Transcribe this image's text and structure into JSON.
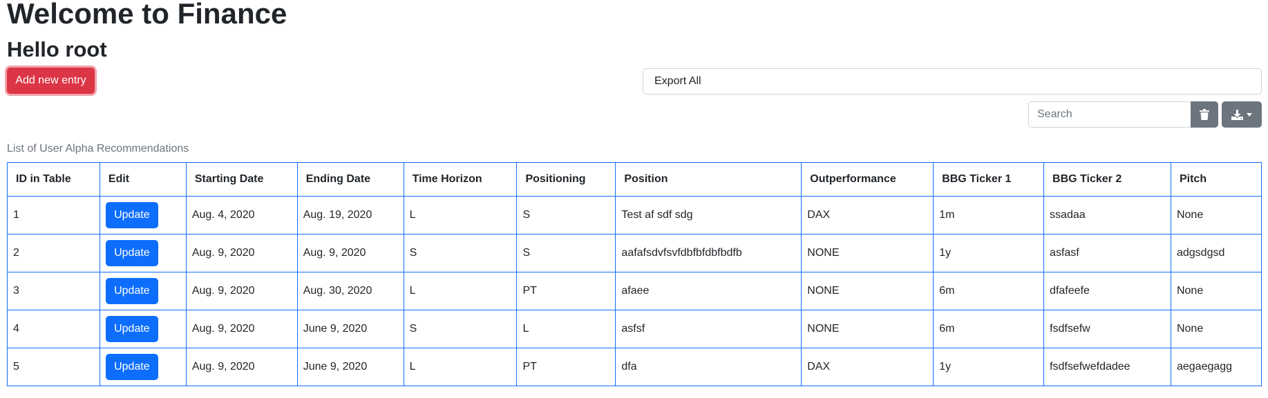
{
  "header": {
    "title": "Welcome to Finance",
    "greeting": "Hello root"
  },
  "actions": {
    "add_label": "Add new entry",
    "export_label": "Export All",
    "search_placeholder": "Search",
    "trash_icon": "trash-icon",
    "download_icon": "download-icon",
    "caret_icon": "caret-down-icon"
  },
  "table": {
    "caption": "List of User Alpha Recommendations",
    "columns": [
      "ID in Table",
      "Edit",
      "Starting Date",
      "Ending Date",
      "Time Horizon",
      "Positioning",
      "Position",
      "Outperformance",
      "BBG Ticker 1",
      "BBG Ticker 2",
      "Pitch"
    ],
    "rows": [
      {
        "id": "1",
        "edit": "Update",
        "start": "Aug. 4, 2020",
        "end": "Aug. 19, 2020",
        "horizon": "L",
        "positioning": "S",
        "position": "Test af sdf sdg",
        "outperformance": "DAX",
        "ticker1": "1m",
        "ticker2": "ssadaa",
        "pitch": "None"
      },
      {
        "id": "2",
        "edit": "Update",
        "start": "Aug. 9, 2020",
        "end": "Aug. 9, 2020",
        "horizon": "S",
        "positioning": "S",
        "position": "aafafsdvfsvfdbfbfdbfbdfb",
        "outperformance": "NONE",
        "ticker1": "1y",
        "ticker2": "asfasf",
        "pitch": "adgsdgsd"
      },
      {
        "id": "3",
        "edit": "Update",
        "start": "Aug. 9, 2020",
        "end": "Aug. 30, 2020",
        "horizon": "L",
        "positioning": "PT",
        "position": "afaee",
        "outperformance": "NONE",
        "ticker1": "6m",
        "ticker2": "dfafeefe",
        "pitch": "None"
      },
      {
        "id": "4",
        "edit": "Update",
        "start": "Aug. 9, 2020",
        "end": "June 9, 2020",
        "horizon": "S",
        "positioning": "L",
        "position": "asfsf",
        "outperformance": "NONE",
        "ticker1": "6m",
        "ticker2": "fsdfsefw",
        "pitch": "None"
      },
      {
        "id": "5",
        "edit": "Update",
        "start": "Aug. 9, 2020",
        "end": "June 9, 2020",
        "horizon": "L",
        "positioning": "PT",
        "position": "dfa",
        "outperformance": "DAX",
        "ticker1": "1y",
        "ticker2": "fsdfsefwefdadee",
        "pitch": "aegaegagg"
      }
    ]
  },
  "colors": {
    "danger": "#dc3545",
    "primary": "#0d6efd",
    "secondary": "#6c757d"
  }
}
